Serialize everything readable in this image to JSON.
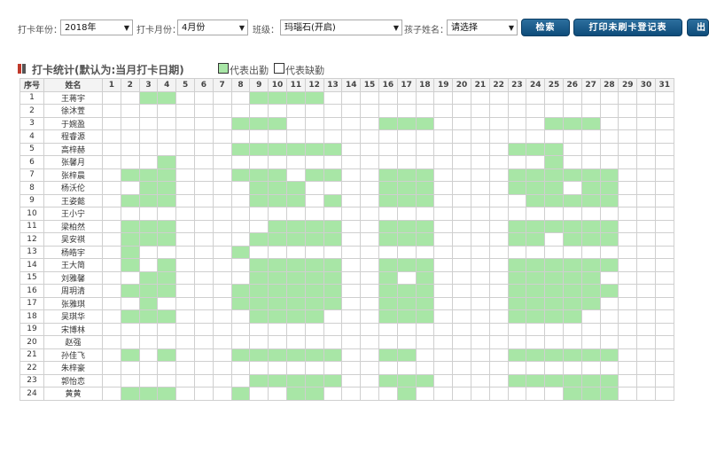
{
  "toolbar": {
    "year_label": "打卡年份：",
    "year_value": "2018年",
    "month_label": "打卡月份：",
    "month_value": "4月份",
    "class_label": "班级：",
    "class_value": "玛瑙石(开启)",
    "child_label": "孩子姓名：",
    "child_value": "请选择",
    "search_label": "检索",
    "print_label": "打印未刷卡登记表",
    "export_label": "出"
  },
  "section": {
    "title": "打卡统计(默认为:当月打卡日期)",
    "legend_present": "代表出勤",
    "legend_absent": "代表缺勤"
  },
  "colors": {
    "present": "#a8e6a6",
    "button": "#1a5a8a",
    "icon_red": "#c0392b",
    "icon_dark": "#555555"
  },
  "table": {
    "headers": [
      "序号",
      "姓名",
      "1",
      "2",
      "3",
      "4",
      "5",
      "6",
      "7",
      "8",
      "9",
      "10",
      "11",
      "12",
      "13",
      "14",
      "15",
      "16",
      "17",
      "18",
      "19",
      "20",
      "21",
      "22",
      "23",
      "24",
      "25",
      "26",
      "27",
      "28",
      "29",
      "30",
      "31"
    ],
    "rows": [
      {
        "no": "1",
        "name": "王蒋宇",
        "present": [
          3,
          4,
          9,
          10,
          11,
          12
        ]
      },
      {
        "no": "2",
        "name": "徐沐萱",
        "present": []
      },
      {
        "no": "3",
        "name": "于婉盈",
        "present": [
          8,
          9,
          10,
          16,
          17,
          18,
          25,
          26,
          27
        ]
      },
      {
        "no": "4",
        "name": "程睿源",
        "present": []
      },
      {
        "no": "5",
        "name": "高梓赫",
        "present": [
          8,
          9,
          10,
          11,
          12,
          13,
          23,
          24,
          25
        ]
      },
      {
        "no": "6",
        "name": "张馨月",
        "present": [
          4,
          25
        ]
      },
      {
        "no": "7",
        "name": "张梓晨",
        "present": [
          2,
          3,
          4,
          8,
          9,
          10,
          12,
          13,
          16,
          17,
          18,
          23,
          24,
          25,
          26,
          27,
          28
        ]
      },
      {
        "no": "8",
        "name": "杨沃伦",
        "present": [
          3,
          4,
          9,
          10,
          11,
          16,
          17,
          18,
          23,
          24,
          25,
          27,
          28
        ]
      },
      {
        "no": "9",
        "name": "王姿懿",
        "present": [
          2,
          3,
          4,
          9,
          10,
          11,
          13,
          16,
          17,
          18,
          24,
          25,
          26,
          27,
          28
        ]
      },
      {
        "no": "10",
        "name": "王小宁",
        "present": []
      },
      {
        "no": "11",
        "name": "梁柏然",
        "present": [
          2,
          3,
          4,
          10,
          11,
          12,
          13,
          16,
          17,
          18,
          23,
          24,
          25,
          26,
          27,
          28
        ]
      },
      {
        "no": "12",
        "name": "吴安祺",
        "present": [
          2,
          3,
          4,
          9,
          10,
          11,
          12,
          13,
          16,
          17,
          18,
          23,
          24,
          26,
          27,
          28
        ]
      },
      {
        "no": "13",
        "name": "杨皓宇",
        "present": [
          2,
          8
        ]
      },
      {
        "no": "14",
        "name": "王大简",
        "present": [
          2,
          4,
          9,
          10,
          11,
          12,
          13,
          16,
          17,
          18,
          23,
          24,
          25,
          26,
          27,
          28
        ]
      },
      {
        "no": "15",
        "name": "刘雅馨",
        "present": [
          3,
          4,
          9,
          10,
          11,
          12,
          13,
          16,
          18,
          23,
          24,
          25,
          26,
          27
        ]
      },
      {
        "no": "16",
        "name": "周玥清",
        "present": [
          2,
          3,
          4,
          8,
          9,
          10,
          11,
          12,
          13,
          16,
          17,
          18,
          23,
          24,
          25,
          26,
          27,
          28
        ]
      },
      {
        "no": "17",
        "name": "张雅琪",
        "present": [
          3,
          8,
          9,
          10,
          11,
          12,
          13,
          16,
          17,
          18,
          23,
          24,
          25,
          26,
          27
        ]
      },
      {
        "no": "18",
        "name": "吴琪华",
        "present": [
          2,
          3,
          4,
          9,
          10,
          11,
          12,
          16,
          17,
          18,
          23,
          24,
          25,
          26
        ]
      },
      {
        "no": "19",
        "name": "宋博林",
        "present": []
      },
      {
        "no": "20",
        "name": "赵强",
        "present": []
      },
      {
        "no": "21",
        "name": "孙佳飞",
        "present": [
          2,
          4,
          8,
          9,
          10,
          11,
          12,
          13,
          16,
          17,
          23,
          24,
          25,
          26,
          27,
          28
        ]
      },
      {
        "no": "22",
        "name": "朱梓豪",
        "present": []
      },
      {
        "no": "23",
        "name": "郭怡恋",
        "present": [
          9,
          10,
          11,
          12,
          13,
          16,
          17,
          18,
          23,
          24,
          25,
          26,
          27,
          28
        ]
      },
      {
        "no": "24",
        "name": "黄黄",
        "present": [
          2,
          3,
          4,
          8,
          11,
          12,
          17,
          26,
          27,
          28
        ]
      }
    ]
  }
}
